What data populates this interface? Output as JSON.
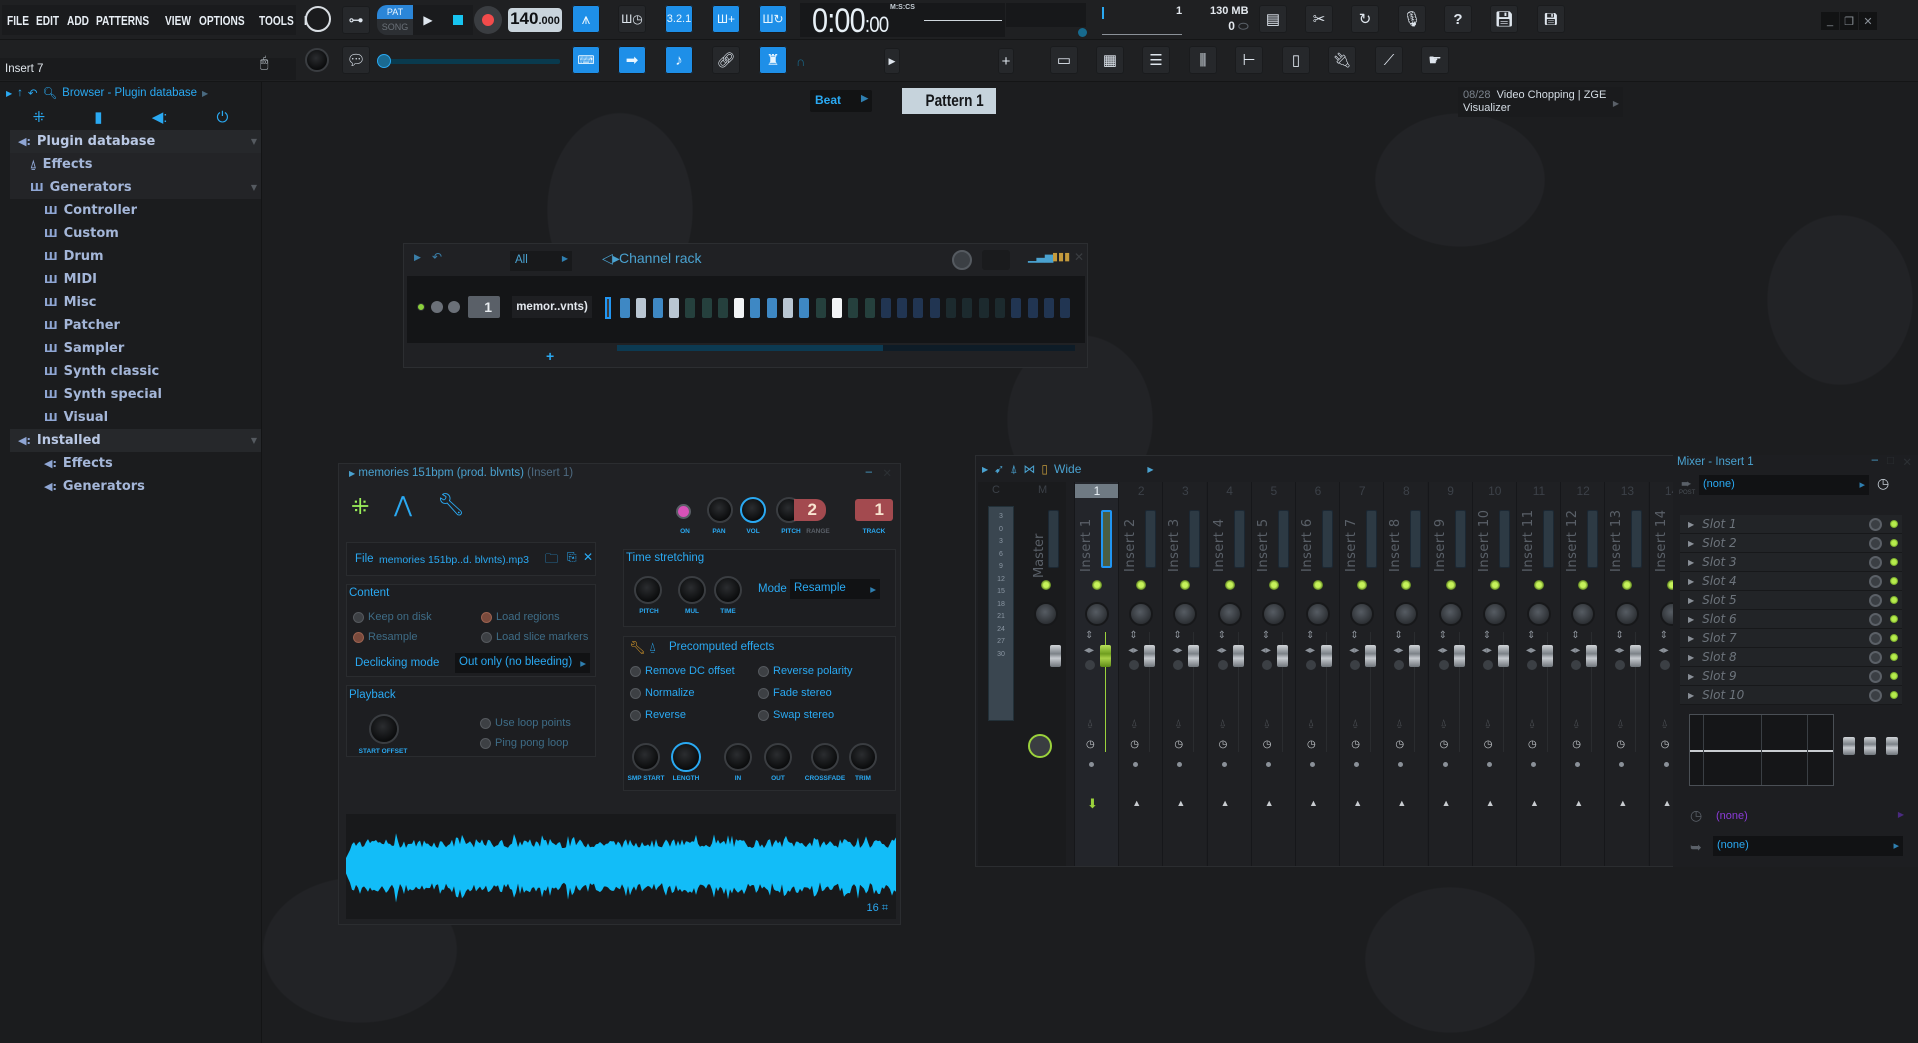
{
  "menu": [
    "FILE",
    "EDIT",
    "ADD",
    "PATTERNS",
    "VIEW",
    "OPTIONS",
    "TOOLS",
    "HELP"
  ],
  "transport": {
    "pat_label": "PAT",
    "song_label": "SONG",
    "mode": "PAT",
    "tempo_int": "140",
    "tempo_dec": ".000",
    "time_main": "0:00",
    "time_cs": ":00",
    "time_format": "M:S:CS"
  },
  "status": {
    "cpu_value": "1",
    "memory": "130 MB",
    "polyphony": "0"
  },
  "hint_bar": {
    "text": "Insert 7"
  },
  "snap": {
    "value": "Beat"
  },
  "pattern": {
    "name": "Pattern 1",
    "add_label": "+"
  },
  "news": {
    "counter": "08/28",
    "text": "Video Chopping | ZGE Visualizer"
  },
  "browser": {
    "title": "Browser - Plugin database",
    "tree": [
      {
        "label": "Plugin database",
        "level": 0,
        "icon": "speaker-icon",
        "expanded": true
      },
      {
        "label": "Effects",
        "level": 1,
        "icon": "plug-icon"
      },
      {
        "label": "Generators",
        "level": 1,
        "icon": "piano-icon",
        "expanded": true
      },
      {
        "label": "Controller",
        "level": 2,
        "icon": "piano-icon"
      },
      {
        "label": "Custom",
        "level": 2,
        "icon": "piano-icon"
      },
      {
        "label": "Drum",
        "level": 2,
        "icon": "piano-icon"
      },
      {
        "label": "MIDI",
        "level": 2,
        "icon": "piano-icon"
      },
      {
        "label": "Misc",
        "level": 2,
        "icon": "piano-icon"
      },
      {
        "label": "Patcher",
        "level": 2,
        "icon": "piano-icon"
      },
      {
        "label": "Sampler",
        "level": 2,
        "icon": "piano-icon"
      },
      {
        "label": "Synth classic",
        "level": 2,
        "icon": "piano-icon"
      },
      {
        "label": "Synth special",
        "level": 2,
        "icon": "piano-icon"
      },
      {
        "label": "Visual",
        "level": 2,
        "icon": "piano-icon"
      },
      {
        "label": "Installed",
        "level": 0,
        "icon": "speaker-icon",
        "expanded": true
      },
      {
        "label": "Effects",
        "level": 2,
        "icon": "speaker-icon"
      },
      {
        "label": "Generators",
        "level": 2,
        "icon": "speaker-icon"
      }
    ]
  },
  "channel_rack": {
    "title": "Channel rack",
    "filter": "All",
    "add_label": "+",
    "channel": {
      "number": "1",
      "name": "memor..vnts)"
    },
    "steps": [
      "blue",
      "light",
      "blue",
      "light",
      "dk1",
      "dk1",
      "dk1",
      "white",
      "blue",
      "blue",
      "light",
      "blue",
      "dk1",
      "white",
      "dk1",
      "dk1",
      "dk2",
      "dk2",
      "dk2",
      "dk2",
      "dk3",
      "dk3",
      "dk3",
      "dk3",
      "dk2",
      "dk2",
      "dk2",
      "dk2"
    ]
  },
  "sampler": {
    "title": "memories 151bpm (prod. blvnts)",
    "insert": "(Insert 1)",
    "knobs": {
      "on": "ON",
      "pan": "PAN",
      "vol": "VOL",
      "pitch": "PITCH",
      "range": "RANGE",
      "track": "TRACK"
    },
    "range_value": "2",
    "track_value": "1",
    "file_label": "File",
    "file_name": "memories 151bp..d. blvnts).mp3",
    "content_label": "Content",
    "content_options": [
      {
        "label": "Keep on disk",
        "state": "off"
      },
      {
        "label": "Load regions",
        "state": "on"
      },
      {
        "label": "Resample",
        "state": "on"
      },
      {
        "label": "Load slice markers",
        "state": "off"
      }
    ],
    "declicking_label": "Declicking mode",
    "declicking_value": "Out only (no bleeding)",
    "playback_label": "Playback",
    "start_offset": "START OFFSET",
    "playback_options": [
      "Use loop points",
      "Ping pong loop"
    ],
    "time_stretch_label": "Time stretching",
    "ts_knobs": [
      "PITCH",
      "MUL",
      "TIME"
    ],
    "mode_label": "Mode",
    "mode_value": "Resample",
    "precomputed_label": "Precomputed effects",
    "effects": [
      "Remove DC offset",
      "Reverse polarity",
      "Normalize",
      "Fade stereo",
      "Reverse",
      "Swap stereo"
    ],
    "effect_knobs": [
      "SMP START",
      "LENGTH",
      "IN",
      "OUT",
      "CROSSFADE",
      "TRIM"
    ],
    "wave_footer": "16"
  },
  "mixer": {
    "preset": "Wide",
    "master_label": "Master",
    "c_label": "C",
    "m_label": "M",
    "meter_scale": [
      "3",
      "0",
      "3",
      "6",
      "9",
      "12",
      "15",
      "18",
      "21",
      "24",
      "27",
      "30"
    ],
    "inserts": [
      "Insert 1",
      "Insert 2",
      "Insert 3",
      "Insert 4",
      "Insert 5",
      "Insert 6",
      "Insert 7",
      "Insert 8",
      "Insert 9",
      "Insert 10",
      "Insert 11",
      "Insert 12",
      "Insert 13",
      "Insert 14"
    ],
    "selected_insert": 1
  },
  "mixer_insert": {
    "title": "Mixer - Insert 1",
    "input": "(none)",
    "post_label": "POST",
    "slots": [
      "Slot 1",
      "Slot 2",
      "Slot 3",
      "Slot 4",
      "Slot 5",
      "Slot 6",
      "Slot 7",
      "Slot 8",
      "Slot 9",
      "Slot 10"
    ],
    "latency": "(none)",
    "output": "(none)"
  }
}
